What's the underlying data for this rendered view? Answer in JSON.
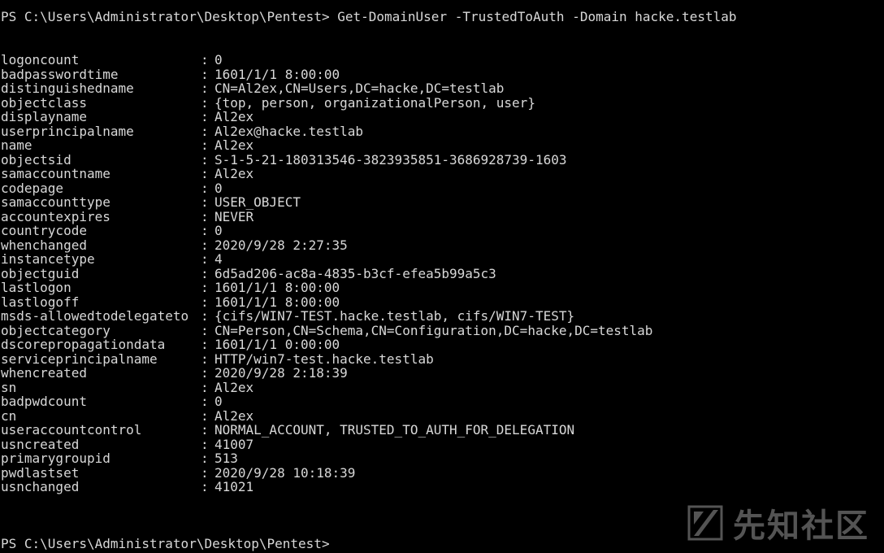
{
  "console": {
    "prompt_command": "PS C:\\Users\\Administrator\\Desktop\\Pentest> Get-DomainUser -TrustedToAuth -Domain hacke.testlab",
    "prompt_end": "PS C:\\Users\\Administrator\\Desktop\\Pentest>",
    "separator": ":",
    "properties": [
      {
        "key": "logoncount",
        "value": "0"
      },
      {
        "key": "badpasswordtime",
        "value": "1601/1/1 8:00:00"
      },
      {
        "key": "distinguishedname",
        "value": "CN=Al2ex,CN=Users,DC=hacke,DC=testlab"
      },
      {
        "key": "objectclass",
        "value": "{top, person, organizationalPerson, user}"
      },
      {
        "key": "displayname",
        "value": "Al2ex"
      },
      {
        "key": "userprincipalname",
        "value": "Al2ex@hacke.testlab"
      },
      {
        "key": "name",
        "value": "Al2ex"
      },
      {
        "key": "objectsid",
        "value": "S-1-5-21-180313546-3823935851-3686928739-1603"
      },
      {
        "key": "samaccountname",
        "value": "Al2ex"
      },
      {
        "key": "codepage",
        "value": "0"
      },
      {
        "key": "samaccounttype",
        "value": "USER_OBJECT"
      },
      {
        "key": "accountexpires",
        "value": "NEVER"
      },
      {
        "key": "countrycode",
        "value": "0"
      },
      {
        "key": "whenchanged",
        "value": "2020/9/28 2:27:35"
      },
      {
        "key": "instancetype",
        "value": "4"
      },
      {
        "key": "objectguid",
        "value": "6d5ad206-ac8a-4835-b3cf-efea5b99a5c3"
      },
      {
        "key": "lastlogon",
        "value": "1601/1/1 8:00:00"
      },
      {
        "key": "lastlogoff",
        "value": "1601/1/1 8:00:00"
      },
      {
        "key": "msds-allowedtodelegateto",
        "value": "{cifs/WIN7-TEST.hacke.testlab, cifs/WIN7-TEST}"
      },
      {
        "key": "objectcategory",
        "value": "CN=Person,CN=Schema,CN=Configuration,DC=hacke,DC=testlab"
      },
      {
        "key": "dscorepropagationdata",
        "value": "1601/1/1 0:00:00"
      },
      {
        "key": "serviceprincipalname",
        "value": "HTTP/win7-test.hacke.testlab"
      },
      {
        "key": "whencreated",
        "value": "2020/9/28 2:18:39"
      },
      {
        "key": "sn",
        "value": "Al2ex"
      },
      {
        "key": "badpwdcount",
        "value": "0"
      },
      {
        "key": "cn",
        "value": "Al2ex"
      },
      {
        "key": "useraccountcontrol",
        "value": "NORMAL_ACCOUNT, TRUSTED_TO_AUTH_FOR_DELEGATION"
      },
      {
        "key": "usncreated",
        "value": "41007"
      },
      {
        "key": "primarygroupid",
        "value": "513"
      },
      {
        "key": "pwdlastset",
        "value": "2020/9/28 10:18:39"
      },
      {
        "key": "usnchanged",
        "value": "41021"
      }
    ]
  },
  "watermark": {
    "text": "先知社区",
    "icon": "xianzhi-logo-icon"
  },
  "colors": {
    "background": "#000000",
    "foreground": "#d8d8d8",
    "watermark": "#9a9a9a"
  }
}
